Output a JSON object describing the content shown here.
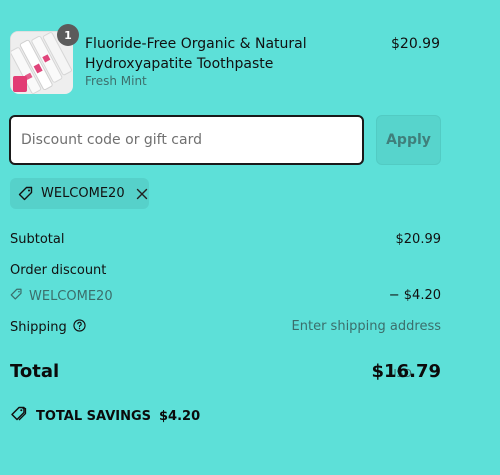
{
  "product": {
    "name": "Fluoride-Free Organic & Natural Hydroxyapatite Toothpaste",
    "variant": "Fresh Mint",
    "price": "$20.99",
    "quantity": "1",
    "thumbnail_icon": "toothpaste-product-image"
  },
  "discount": {
    "placeholder": "Discount code or gift card",
    "value": "",
    "apply_label": "Apply"
  },
  "applied_code": {
    "code": "WELCOME20",
    "icon": "tag-icon",
    "remove_icon": "close-icon"
  },
  "summary": {
    "subtotal_label": "Subtotal",
    "subtotal_value": "$20.99",
    "order_discount_label": "Order discount",
    "discount_code": "WELCOME20",
    "discount_value": "− $4.20",
    "shipping_label": "Shipping",
    "shipping_value": "Enter shipping address",
    "total_label": "Total",
    "currency": "USD",
    "total_value": "$16.79",
    "savings_label": "TOTAL SAVINGS",
    "savings_value": "$4.20"
  },
  "colors": {
    "background": "#5de0d8",
    "muted_text": "#3b6e6b",
    "badge": "#5b5b5b"
  }
}
